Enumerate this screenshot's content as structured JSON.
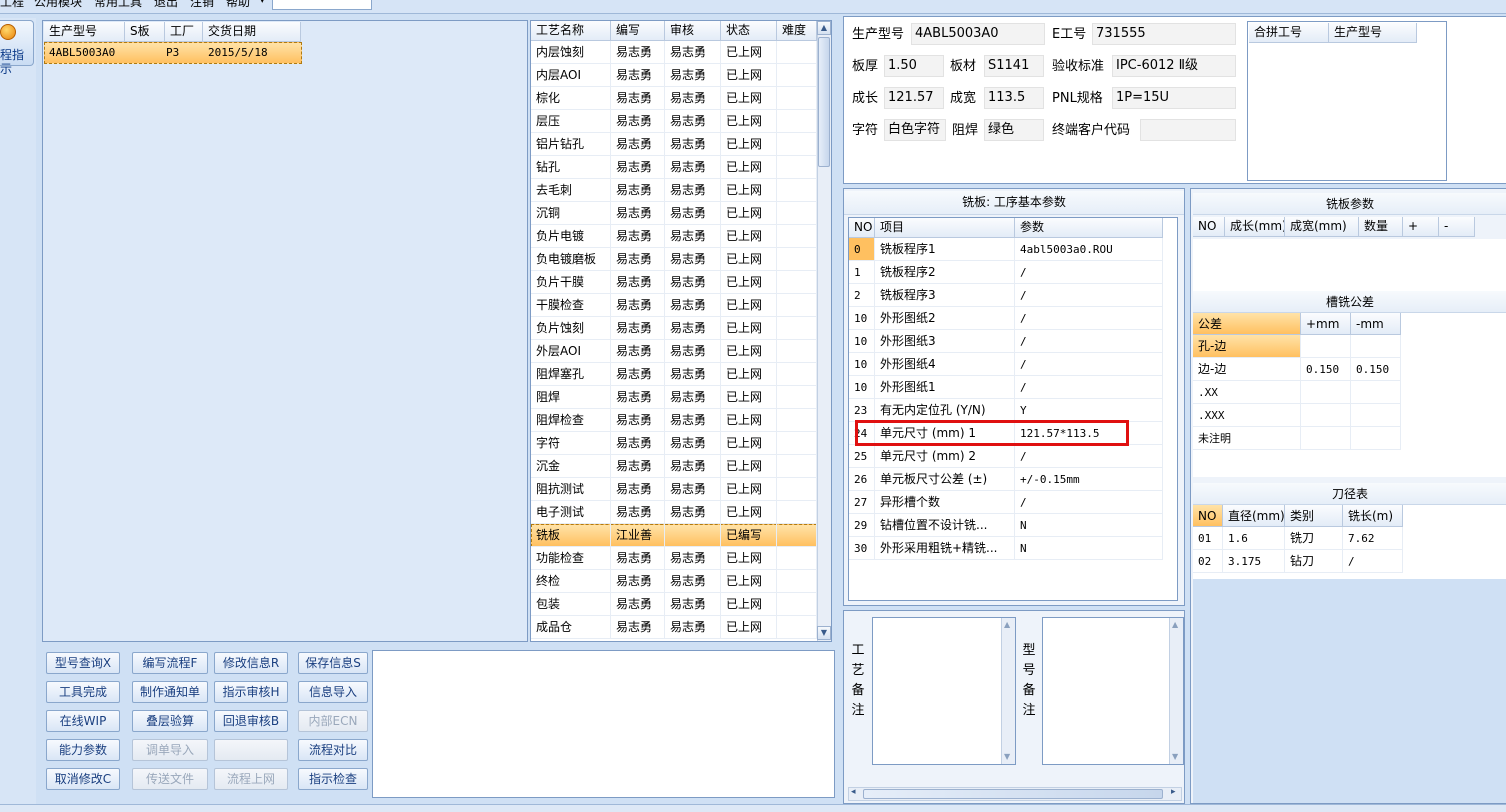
{
  "menu": {
    "items": [
      "工程",
      "公用模块",
      "常用工具",
      "退出",
      "注销",
      "帮助"
    ]
  },
  "guide": {
    "label": "程指示"
  },
  "orders": {
    "headers": [
      "生产型号",
      "S板",
      "工厂",
      "交货日期"
    ],
    "rows": [
      {
        "model": "4ABL5003A0",
        "s": "",
        "factory": "P3",
        "date": "2015/5/18"
      }
    ]
  },
  "process": {
    "headers": [
      "工艺名称",
      "编写",
      "审核",
      "状态",
      "难度"
    ],
    "rows": [
      [
        "内层蚀刻",
        "易志勇",
        "易志勇",
        "已上网",
        ""
      ],
      [
        "内层AOI",
        "易志勇",
        "易志勇",
        "已上网",
        ""
      ],
      [
        "棕化",
        "易志勇",
        "易志勇",
        "已上网",
        ""
      ],
      [
        "层压",
        "易志勇",
        "易志勇",
        "已上网",
        ""
      ],
      [
        "铝片钻孔",
        "易志勇",
        "易志勇",
        "已上网",
        ""
      ],
      [
        "钻孔",
        "易志勇",
        "易志勇",
        "已上网",
        ""
      ],
      [
        "去毛刺",
        "易志勇",
        "易志勇",
        "已上网",
        ""
      ],
      [
        "沉铜",
        "易志勇",
        "易志勇",
        "已上网",
        ""
      ],
      [
        "负片电镀",
        "易志勇",
        "易志勇",
        "已上网",
        ""
      ],
      [
        "负电镀磨板",
        "易志勇",
        "易志勇",
        "已上网",
        ""
      ],
      [
        "负片干膜",
        "易志勇",
        "易志勇",
        "已上网",
        ""
      ],
      [
        "干膜检查",
        "易志勇",
        "易志勇",
        "已上网",
        ""
      ],
      [
        "负片蚀刻",
        "易志勇",
        "易志勇",
        "已上网",
        ""
      ],
      [
        "外层AOI",
        "易志勇",
        "易志勇",
        "已上网",
        ""
      ],
      [
        "阻焊塞孔",
        "易志勇",
        "易志勇",
        "已上网",
        ""
      ],
      [
        "阻焊",
        "易志勇",
        "易志勇",
        "已上网",
        ""
      ],
      [
        "阻焊检查",
        "易志勇",
        "易志勇",
        "已上网",
        ""
      ],
      [
        "字符",
        "易志勇",
        "易志勇",
        "已上网",
        ""
      ],
      [
        "沉金",
        "易志勇",
        "易志勇",
        "已上网",
        ""
      ],
      [
        "阻抗测试",
        "易志勇",
        "易志勇",
        "已上网",
        ""
      ],
      [
        "电子测试",
        "易志勇",
        "易志勇",
        "已上网",
        ""
      ],
      [
        "铣板",
        "江业善",
        "",
        "已编写",
        ""
      ],
      [
        "功能检查",
        "易志勇",
        "易志勇",
        "已上网",
        ""
      ],
      [
        "终检",
        "易志勇",
        "易志勇",
        "已上网",
        ""
      ],
      [
        "包装",
        "易志勇",
        "易志勇",
        "已上网",
        ""
      ],
      [
        "成品仓",
        "易志勇",
        "易志勇",
        "已上网",
        ""
      ]
    ],
    "selected_index": 21
  },
  "buttons": [
    [
      "型号查询X",
      "编写流程F",
      "修改信息R",
      "保存信息S"
    ],
    [
      "工具完成",
      "制作通知单",
      "指示审核H",
      "信息导入"
    ],
    [
      "在线WIP",
      "叠层验算",
      "回退审核B",
      "内部ECN"
    ],
    [
      "能力参数",
      "调单导入",
      "",
      "流程对比"
    ],
    [
      "取消修改C",
      "传送文件",
      "流程上网",
      "指示检查"
    ]
  ],
  "disabled_buttons": [
    "内部ECN",
    "调单导入",
    "",
    "传送文件",
    "流程上网"
  ],
  "info": {
    "labels": {
      "model": "生产型号",
      "eno": "E工号",
      "thick": "板厚",
      "material": "板材",
      "standard": "验收标准",
      "len": "成长",
      "wid": "成宽",
      "pnl": "PNL规格",
      "char": "字符",
      "mask": "阻焊",
      "cust": "终端客户代码"
    },
    "values": {
      "model": "4ABL5003A0",
      "eno": "731555",
      "thick": "1.50",
      "material": "S1141",
      "standard": "IPC-6012 Ⅱ级",
      "len": "121.57",
      "wid": "113.5",
      "pnl": "1P=15U",
      "char": "白色字符",
      "mask": "绿色",
      "cust": ""
    }
  },
  "merge": {
    "headers": [
      "合拼工号",
      "生产型号"
    ]
  },
  "milling": {
    "title": "铣板: 工序基本参数",
    "headers": [
      "NO",
      "项目",
      "参数"
    ],
    "rows": [
      [
        "0",
        "铣板程序1",
        "4abl5003a0.ROU"
      ],
      [
        "1",
        "铣板程序2",
        "/"
      ],
      [
        "2",
        "铣板程序3",
        "/"
      ],
      [
        "10",
        "外形图纸2",
        "/"
      ],
      [
        "10",
        "外形图纸3",
        "/"
      ],
      [
        "10",
        "外形图纸4",
        "/"
      ],
      [
        "10",
        "外形图纸1",
        "/"
      ],
      [
        "23",
        "有无内定位孔 (Y/N)",
        "Y"
      ],
      [
        "24",
        "单元尺寸 (mm) 1",
        "121.57*113.5"
      ],
      [
        "25",
        "单元尺寸 (mm) 2",
        "/"
      ],
      [
        "26",
        "单元板尺寸公差 (±)",
        "+/-0.15mm"
      ],
      [
        "27",
        "异形槽个数",
        "/"
      ],
      [
        "29",
        "钻槽位置不设计铣...",
        "N"
      ],
      [
        "30",
        "外形采用粗铣+精铣...",
        "N"
      ]
    ],
    "highlight_index": 8,
    "highlight_color": "#e01010"
  },
  "board_params": {
    "title": "铣板参数",
    "headers": [
      "NO",
      "成长(mm)",
      "成宽(mm)",
      "数量",
      "+",
      "-"
    ]
  },
  "slot_tol": {
    "title": "槽铣公差",
    "headers": [
      "公差",
      "+mm",
      "-mm"
    ],
    "rows": [
      [
        "孔-边",
        "",
        ""
      ],
      [
        "边-边",
        "0.150",
        "0.150"
      ],
      [
        ".XX",
        "",
        ""
      ],
      [
        ".XXX",
        "",
        ""
      ],
      [
        "未注明",
        "",
        ""
      ]
    ]
  },
  "tools": {
    "title": "刀径表",
    "headers": [
      "NO",
      "直径(mm)",
      "类别",
      "铣长(m)"
    ],
    "rows": [
      [
        "01",
        "1.6",
        "铣刀",
        "7.62"
      ],
      [
        "02",
        "3.175",
        "钻刀",
        "/"
      ]
    ]
  },
  "notes": {
    "process_label": "工艺备注",
    "model_label": "型号备注"
  },
  "colors": {
    "accent": "#ffc060",
    "window": "#cfe0f4",
    "panel_border": "#7d9bc4"
  }
}
